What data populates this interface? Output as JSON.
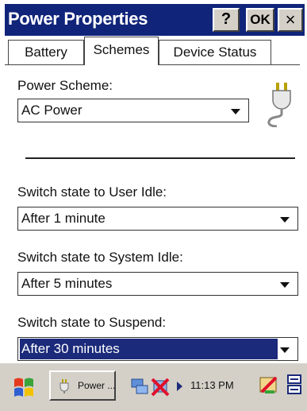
{
  "window": {
    "title": "Power Properties",
    "help_label": "?",
    "ok_label": "OK",
    "close_label": "×"
  },
  "tabs": [
    {
      "label": "Battery",
      "active": false
    },
    {
      "label": "Schemes",
      "active": true
    },
    {
      "label": "Device Status",
      "active": false
    }
  ],
  "power_scheme": {
    "label": "Power Scheme:",
    "value": "AC Power"
  },
  "user_idle": {
    "label": "Switch state to User Idle:",
    "value": "After 1 minute"
  },
  "system_idle": {
    "label": "Switch state to System Idle:",
    "value": "After 5 minutes"
  },
  "suspend": {
    "label": "Switch state to Suspend:",
    "value": "After 30 minutes"
  },
  "taskbar": {
    "task_label": "Power ...",
    "clock": "11:13 PM"
  },
  "colors": {
    "titlebar": "#10247a",
    "selection": "#1b2a7a",
    "chrome": "#d4d0c8"
  }
}
